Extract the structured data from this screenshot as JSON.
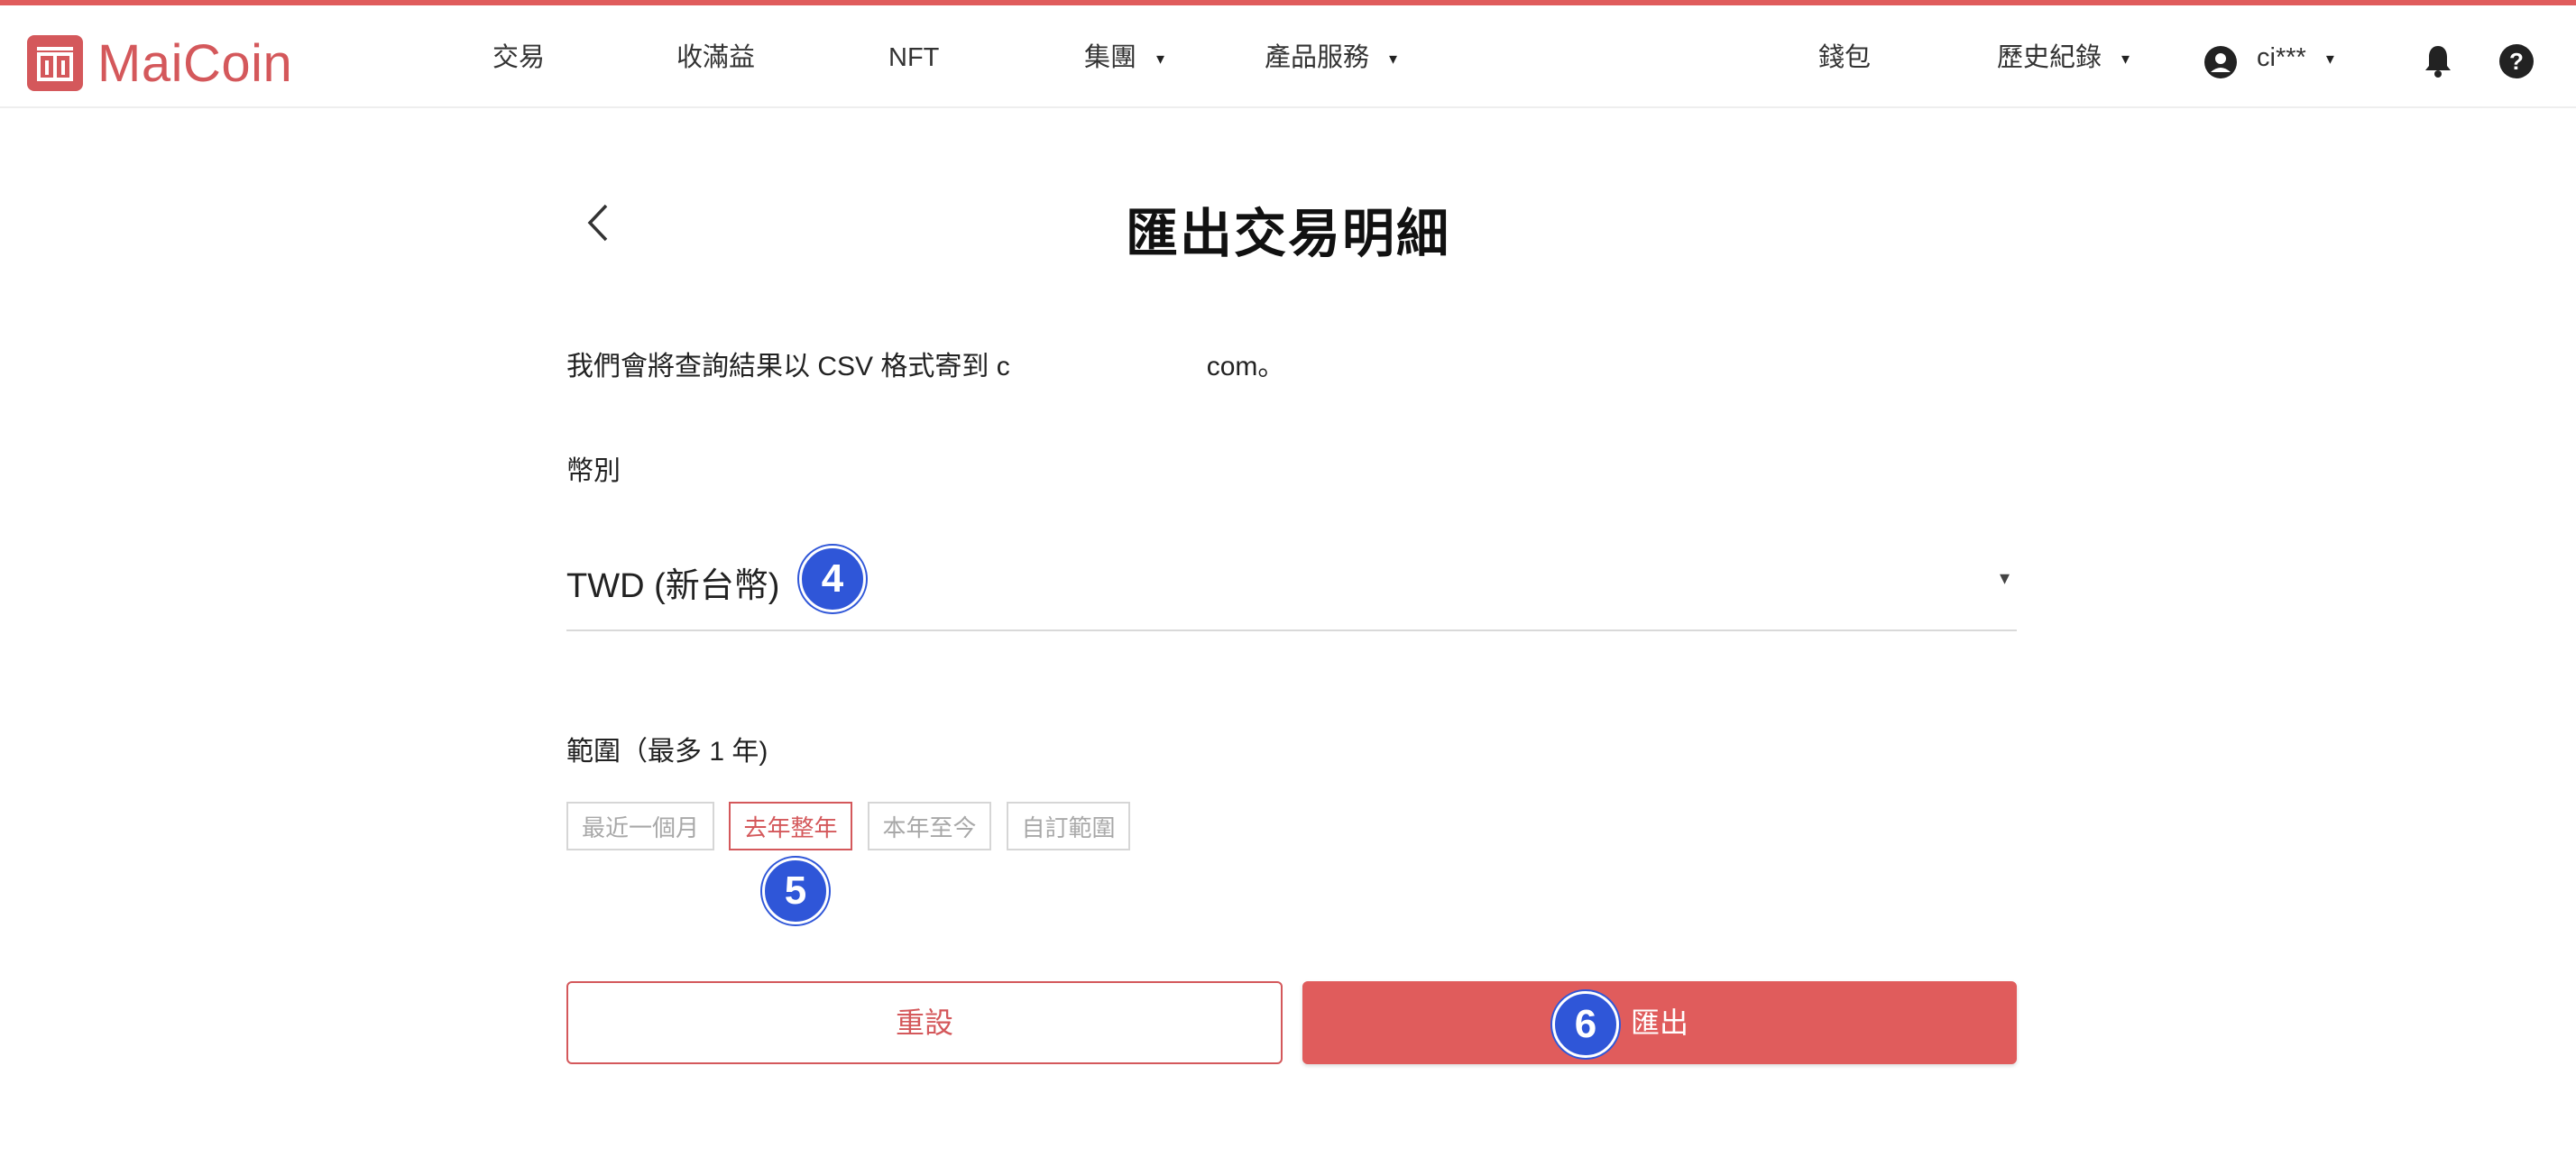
{
  "brand": {
    "name": "MaiCoin",
    "color": "#d4585b"
  },
  "nav": {
    "items": [
      {
        "label": "交易",
        "icon": ""
      },
      {
        "label": "收滿益"
      },
      {
        "label": "NFT"
      },
      {
        "label": "集團",
        "caret": "▾"
      },
      {
        "label": "產品服務",
        "caret": "▾"
      }
    ],
    "right": {
      "wallet": "錢包",
      "history": "歷史紀錄",
      "history_caret": "▾",
      "user": "ci***",
      "user_caret": "▾",
      "icons": [
        "user-circle-icon",
        "bell-icon",
        "help-circle-icon"
      ]
    }
  },
  "page": {
    "title": "匯出交易明細",
    "description_prefix": "我們會將查詢結果以 CSV 格式寄到 c",
    "description_suffix": "com。"
  },
  "currency": {
    "label": "幣別",
    "selected": "TWD (新台幣)",
    "caret": "▾"
  },
  "range": {
    "label": "範圍（最多 1 年)",
    "options": [
      {
        "label": "最近一個月",
        "active": false
      },
      {
        "label": "去年整年",
        "active": true
      },
      {
        "label": "本年至今",
        "active": false
      },
      {
        "label": "自訂範圍",
        "active": false
      }
    ]
  },
  "buttons": {
    "reset": "重設",
    "export": "匯出"
  },
  "steps": {
    "currency": "4",
    "range": "5",
    "export": "6"
  },
  "colors": {
    "accent": "#e05c5c",
    "step_badge": "#2f56d8"
  }
}
